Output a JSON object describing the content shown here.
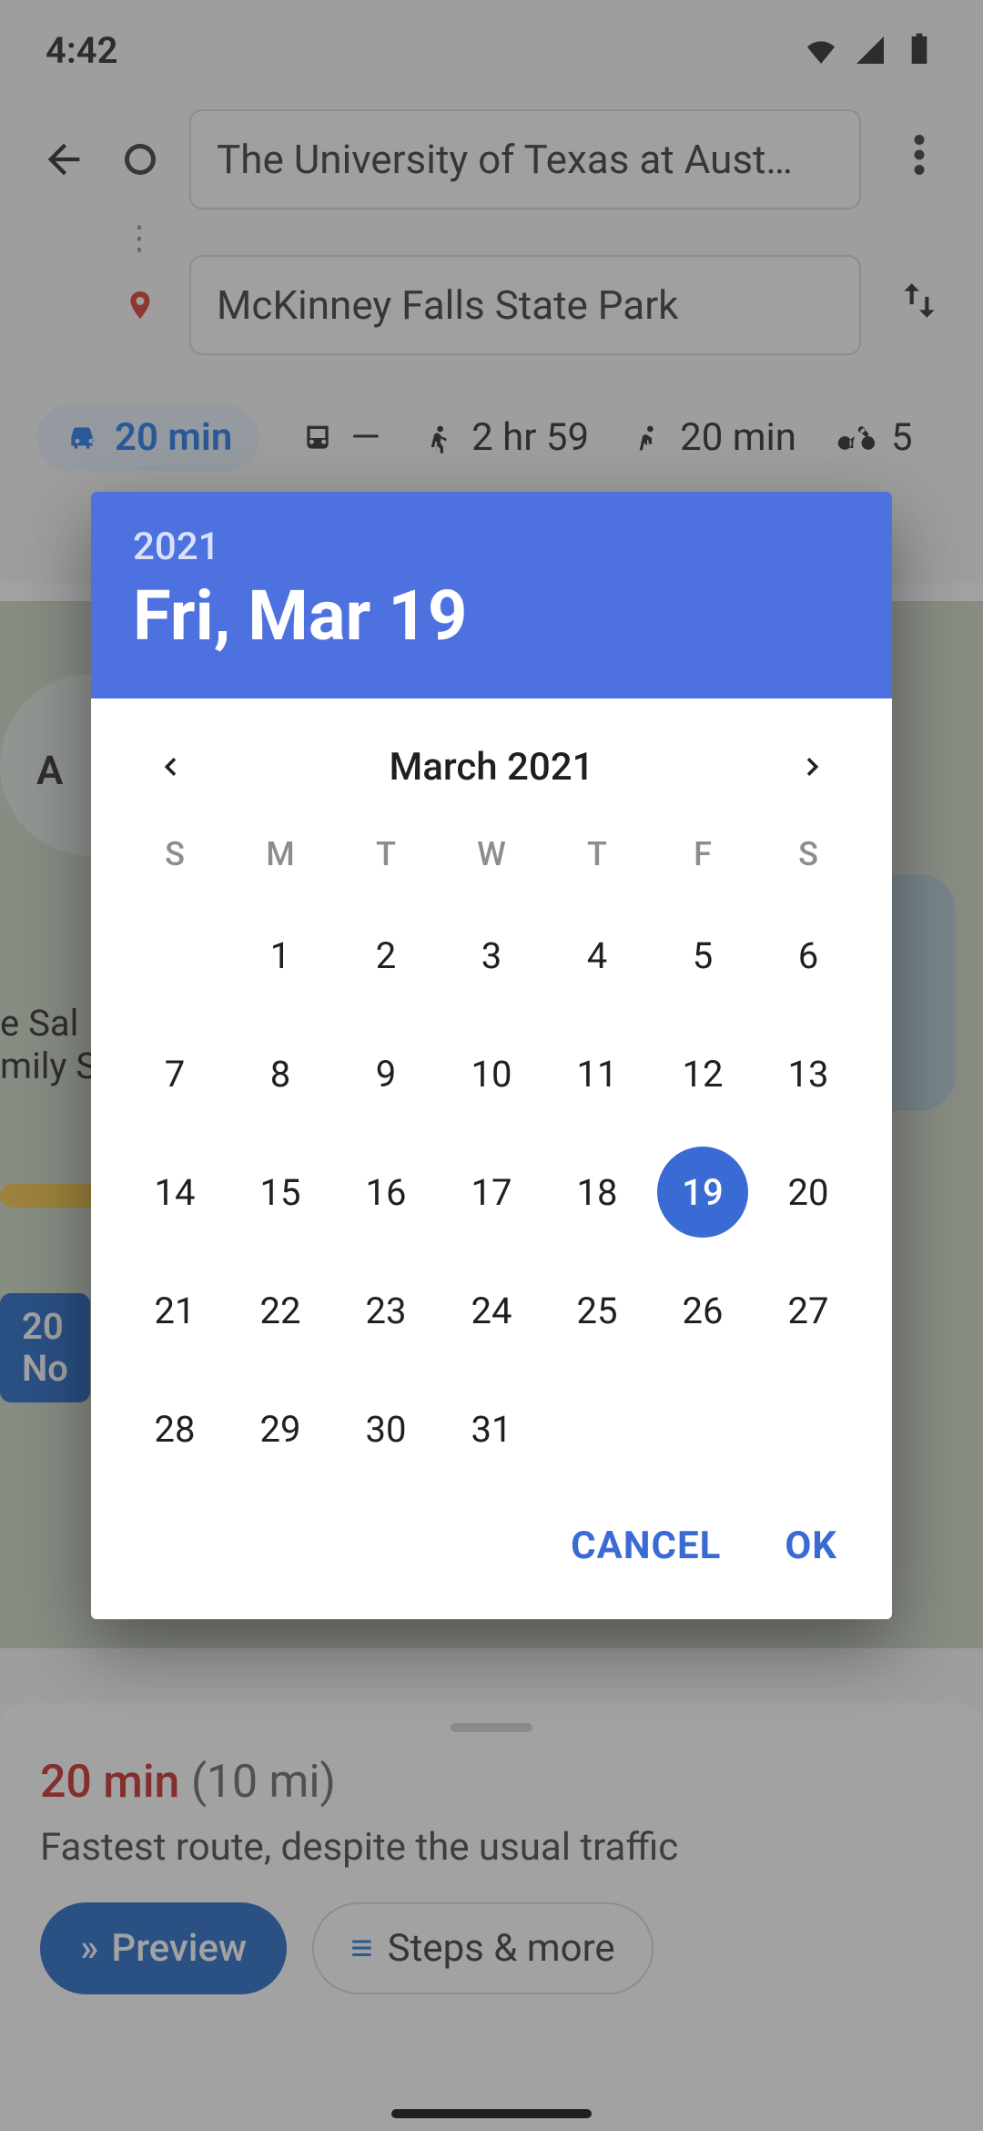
{
  "status": {
    "time": "4:42"
  },
  "directions": {
    "origin": "The University of Texas at Aust…",
    "destination": "McKinney Falls State Park",
    "modes": {
      "drive": "20 min",
      "transit": "—",
      "walk": "2 hr 59",
      "ride": "20 min",
      "bike": "5"
    }
  },
  "bottom_sheet": {
    "duration": "20 min",
    "distance": "(10 mi)",
    "description": "Fastest route, despite the usual traffic",
    "preview_label": "Preview",
    "steps_label": "Steps & more"
  },
  "map_label": {
    "line1": "20",
    "line2": "No"
  },
  "date_picker": {
    "year": "2021",
    "selected_display": "Fri, Mar 19",
    "month_title": "March 2021",
    "weekdays": [
      "S",
      "M",
      "T",
      "W",
      "T",
      "F",
      "S"
    ],
    "leading_blanks": 1,
    "days_in_month": 31,
    "selected_day": 19,
    "actions": {
      "cancel": "CANCEL",
      "ok": "OK"
    }
  }
}
